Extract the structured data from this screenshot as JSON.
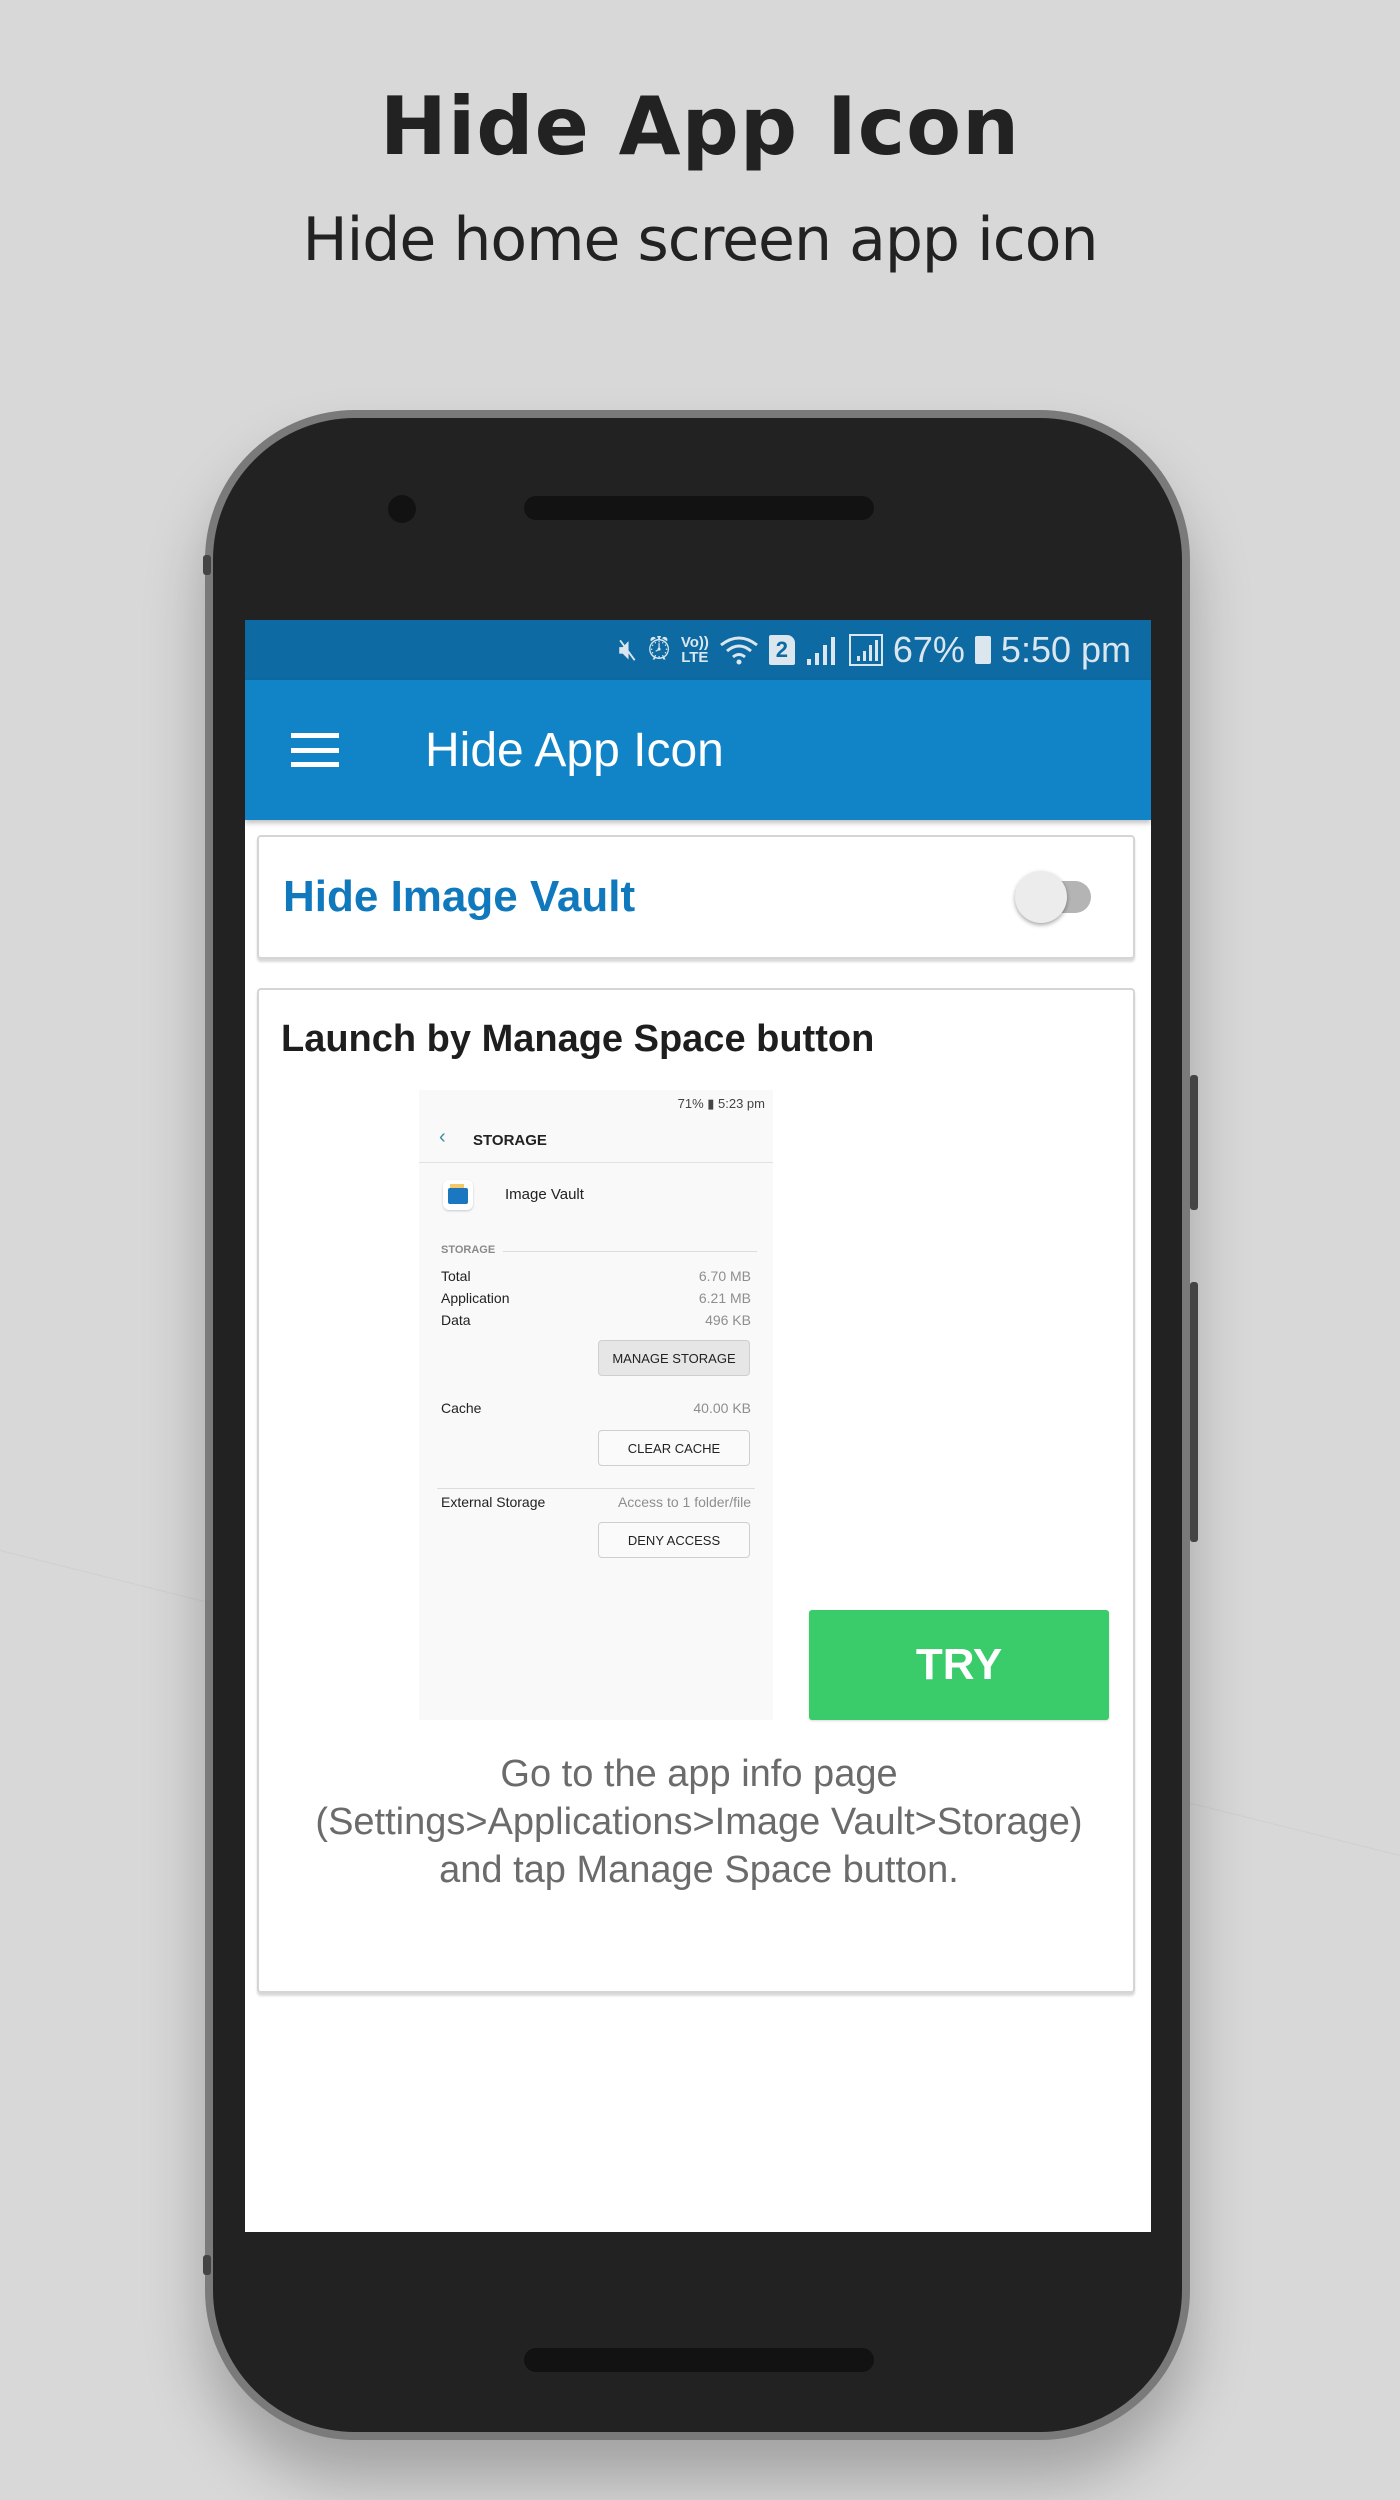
{
  "promo": {
    "title": "Hide App Icon",
    "subtitle": "Hide home screen app icon"
  },
  "status_bar": {
    "icons": [
      "mute-icon",
      "alarm-icon",
      "volte-icon",
      "wifi-icon",
      "sim2-icon",
      "signal-icon",
      "signal-boxed-icon",
      "battery-icon"
    ],
    "volte_top": "Vo))",
    "volte_bottom": "LTE",
    "sim_number": "2",
    "battery": "67%",
    "time": "5:50 pm"
  },
  "app_bar": {
    "title": "Hide App Icon",
    "color": "#1183c7"
  },
  "toggle_card": {
    "label": "Hide Image Vault",
    "enabled": false
  },
  "manage_card": {
    "heading": "Launch by Manage Space button",
    "screenshot": {
      "status_text": "71% ▮ 5:23 pm",
      "header_title": "STORAGE",
      "app_name": "Image Vault",
      "section_label": "STORAGE",
      "rows": [
        {
          "label": "Total",
          "value": "6.70 MB"
        },
        {
          "label": "Application",
          "value": "6.21 MB"
        },
        {
          "label": "Data",
          "value": "496 KB"
        }
      ],
      "manage_storage_button": "MANAGE STORAGE",
      "cache_row": {
        "label": "Cache",
        "value": "40.00 KB"
      },
      "clear_cache_button": "CLEAR CACHE",
      "external_row": {
        "label": "External Storage",
        "value": "Access to 1 folder/file"
      },
      "deny_access_button": "DENY ACCESS"
    },
    "try_button": "TRY",
    "try_color": "#3acc6a",
    "instructions": "Go to the app info page (Settings>Applications>Image Vault>Storage) and tap Manage Space button."
  }
}
